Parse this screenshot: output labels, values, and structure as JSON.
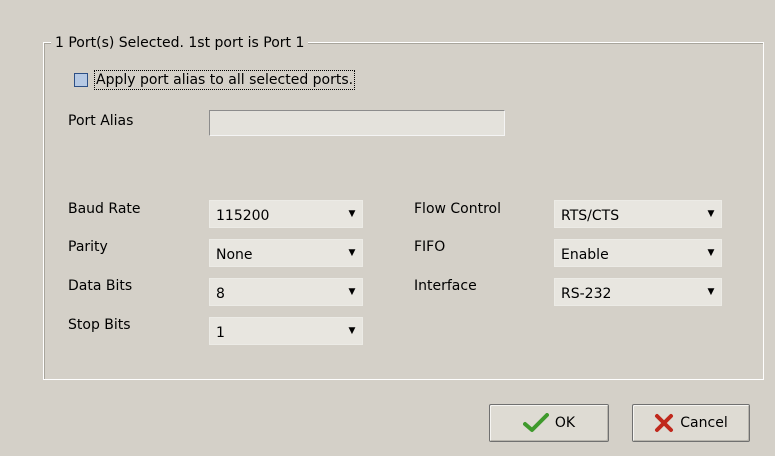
{
  "group": {
    "title": "1 Port(s) Selected. 1st port is Port 1"
  },
  "apply_alias": {
    "label": "Apply port alias to all selected ports.",
    "checked": false
  },
  "port_alias": {
    "label": "Port Alias",
    "value": ""
  },
  "settings": {
    "baud_rate": {
      "label": "Baud Rate",
      "value": "115200"
    },
    "parity": {
      "label": "Parity",
      "value": "None"
    },
    "data_bits": {
      "label": "Data Bits",
      "value": "8"
    },
    "stop_bits": {
      "label": "Stop Bits",
      "value": "1"
    },
    "flow_control": {
      "label": "Flow Control",
      "value": "RTS/CTS"
    },
    "fifo": {
      "label": "FIFO",
      "value": "Enable"
    },
    "interface": {
      "label": "Interface",
      "value": "RS-232"
    }
  },
  "buttons": {
    "ok": {
      "label": "OK",
      "icon": "check-icon"
    },
    "cancel": {
      "label": "Cancel",
      "icon": "x-icon"
    }
  },
  "colors": {
    "background": "#d4d0c8",
    "ok_icon": "#3f9a2c",
    "cancel_icon": "#c0281c"
  }
}
